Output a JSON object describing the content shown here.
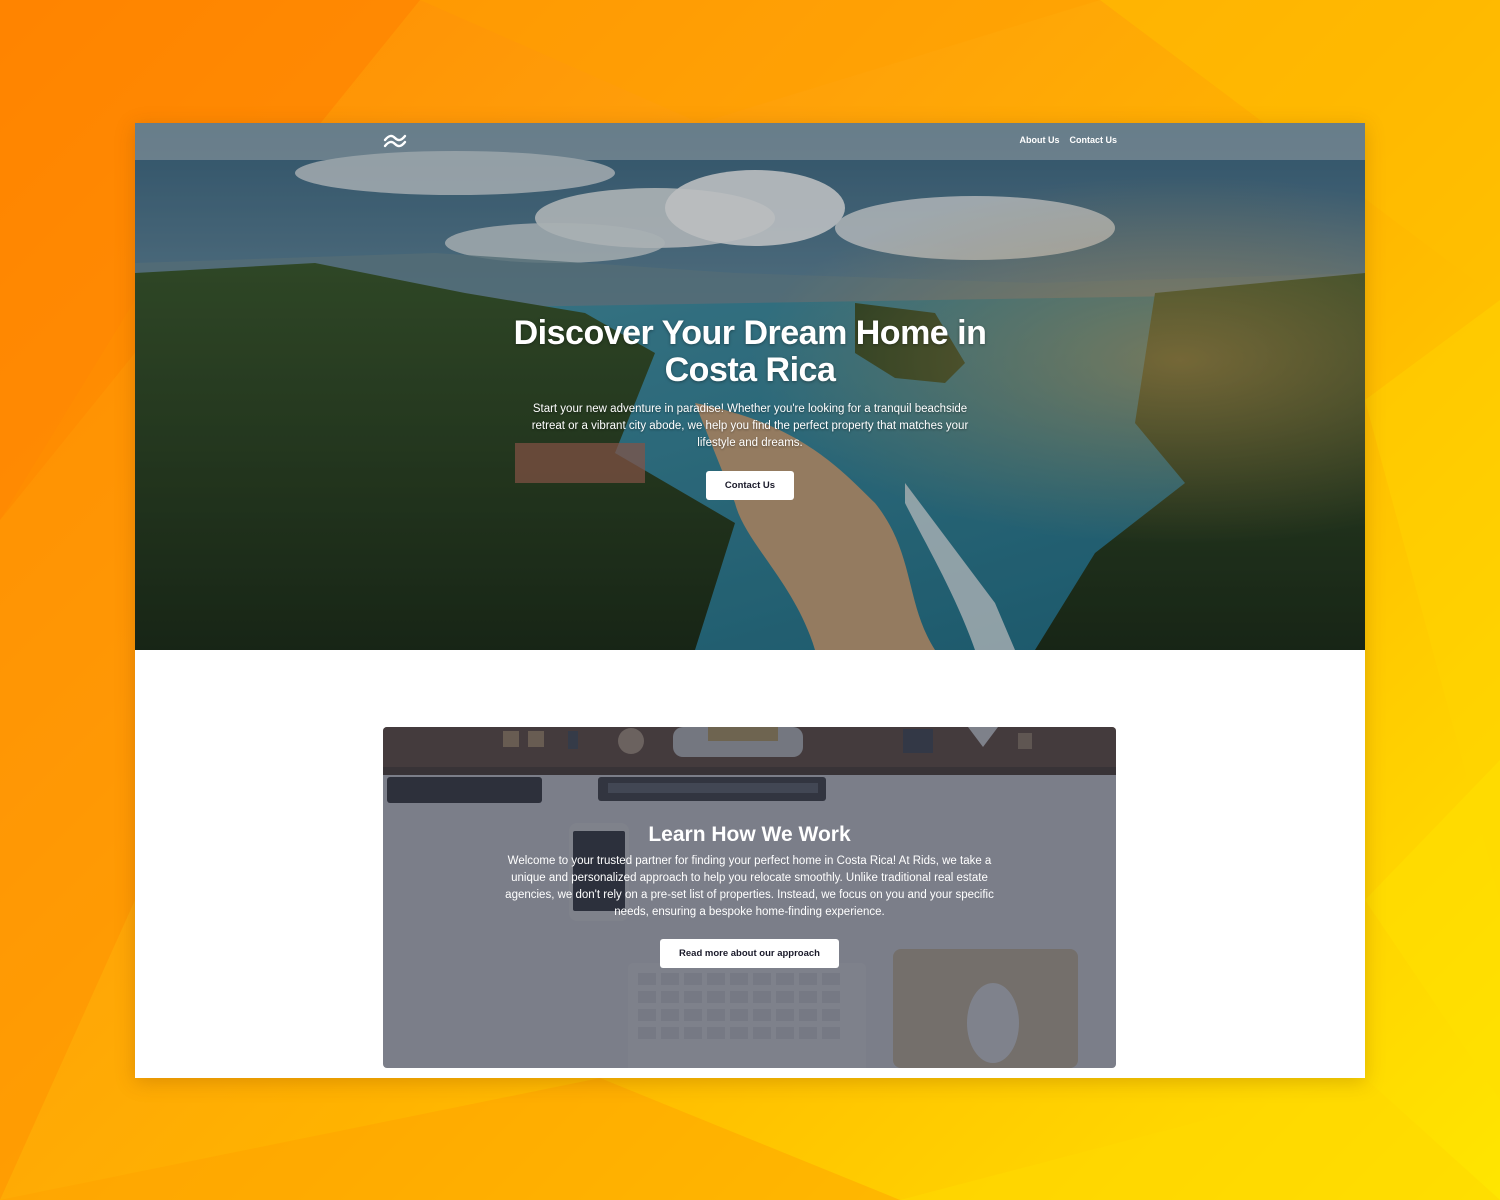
{
  "nav": {
    "logo_icon": "wave-logo-icon",
    "links": [
      {
        "label": "About Us"
      },
      {
        "label": "Contact Us"
      }
    ]
  },
  "hero": {
    "title": "Discover Your Dream Home in Costa Rica",
    "text": "Start your new adventure in paradise! Whether you're looking for a tranquil beachside retreat or a vibrant city abode, we help you find the perfect property that matches your lifestyle and dreams.",
    "button_label": "Contact Us"
  },
  "work": {
    "title": "Learn How We Work",
    "text": "Welcome to your trusted partner for finding your perfect home in Costa Rica! At Rids, we take a unique and personalized approach to help you relocate smoothly. Unlike traditional real estate agencies, we don't rely on a pre-set list of properties. Instead, we focus on you and your specific needs, ensuring a bespoke home-finding experience.",
    "button_label": "Read more about our approach"
  },
  "colors": {
    "background_orange": "#ff8a00",
    "background_yellow": "#ffe600",
    "button_bg": "#ffffff",
    "button_text": "#1a1a2a"
  }
}
